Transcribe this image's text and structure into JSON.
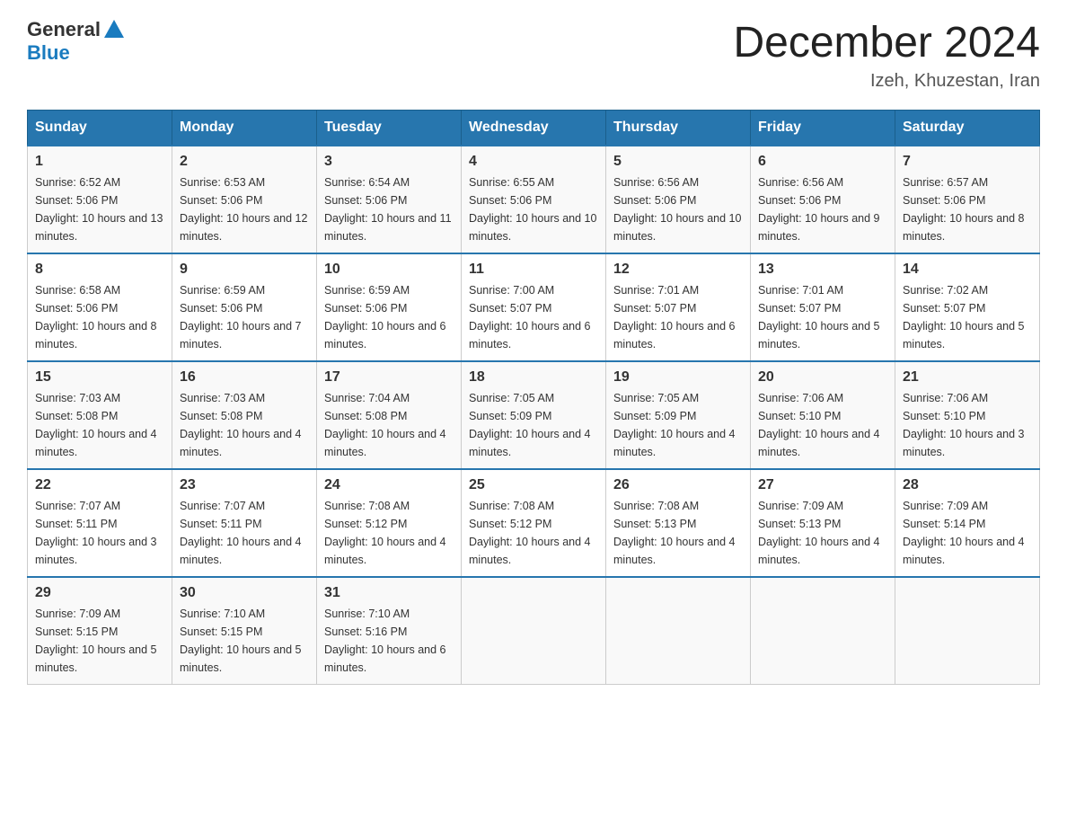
{
  "header": {
    "logo_general": "General",
    "logo_blue": "Blue",
    "month_title": "December 2024",
    "location": "Izeh, Khuzestan, Iran"
  },
  "weekdays": [
    "Sunday",
    "Monday",
    "Tuesday",
    "Wednesday",
    "Thursday",
    "Friday",
    "Saturday"
  ],
  "weeks": [
    [
      {
        "day": "1",
        "sunrise": "6:52 AM",
        "sunset": "5:06 PM",
        "daylight": "10 hours and 13 minutes."
      },
      {
        "day": "2",
        "sunrise": "6:53 AM",
        "sunset": "5:06 PM",
        "daylight": "10 hours and 12 minutes."
      },
      {
        "day": "3",
        "sunrise": "6:54 AM",
        "sunset": "5:06 PM",
        "daylight": "10 hours and 11 minutes."
      },
      {
        "day": "4",
        "sunrise": "6:55 AM",
        "sunset": "5:06 PM",
        "daylight": "10 hours and 10 minutes."
      },
      {
        "day": "5",
        "sunrise": "6:56 AM",
        "sunset": "5:06 PM",
        "daylight": "10 hours and 10 minutes."
      },
      {
        "day": "6",
        "sunrise": "6:56 AM",
        "sunset": "5:06 PM",
        "daylight": "10 hours and 9 minutes."
      },
      {
        "day": "7",
        "sunrise": "6:57 AM",
        "sunset": "5:06 PM",
        "daylight": "10 hours and 8 minutes."
      }
    ],
    [
      {
        "day": "8",
        "sunrise": "6:58 AM",
        "sunset": "5:06 PM",
        "daylight": "10 hours and 8 minutes."
      },
      {
        "day": "9",
        "sunrise": "6:59 AM",
        "sunset": "5:06 PM",
        "daylight": "10 hours and 7 minutes."
      },
      {
        "day": "10",
        "sunrise": "6:59 AM",
        "sunset": "5:06 PM",
        "daylight": "10 hours and 6 minutes."
      },
      {
        "day": "11",
        "sunrise": "7:00 AM",
        "sunset": "5:07 PM",
        "daylight": "10 hours and 6 minutes."
      },
      {
        "day": "12",
        "sunrise": "7:01 AM",
        "sunset": "5:07 PM",
        "daylight": "10 hours and 6 minutes."
      },
      {
        "day": "13",
        "sunrise": "7:01 AM",
        "sunset": "5:07 PM",
        "daylight": "10 hours and 5 minutes."
      },
      {
        "day": "14",
        "sunrise": "7:02 AM",
        "sunset": "5:07 PM",
        "daylight": "10 hours and 5 minutes."
      }
    ],
    [
      {
        "day": "15",
        "sunrise": "7:03 AM",
        "sunset": "5:08 PM",
        "daylight": "10 hours and 4 minutes."
      },
      {
        "day": "16",
        "sunrise": "7:03 AM",
        "sunset": "5:08 PM",
        "daylight": "10 hours and 4 minutes."
      },
      {
        "day": "17",
        "sunrise": "7:04 AM",
        "sunset": "5:08 PM",
        "daylight": "10 hours and 4 minutes."
      },
      {
        "day": "18",
        "sunrise": "7:05 AM",
        "sunset": "5:09 PM",
        "daylight": "10 hours and 4 minutes."
      },
      {
        "day": "19",
        "sunrise": "7:05 AM",
        "sunset": "5:09 PM",
        "daylight": "10 hours and 4 minutes."
      },
      {
        "day": "20",
        "sunrise": "7:06 AM",
        "sunset": "5:10 PM",
        "daylight": "10 hours and 4 minutes."
      },
      {
        "day": "21",
        "sunrise": "7:06 AM",
        "sunset": "5:10 PM",
        "daylight": "10 hours and 3 minutes."
      }
    ],
    [
      {
        "day": "22",
        "sunrise": "7:07 AM",
        "sunset": "5:11 PM",
        "daylight": "10 hours and 3 minutes."
      },
      {
        "day": "23",
        "sunrise": "7:07 AM",
        "sunset": "5:11 PM",
        "daylight": "10 hours and 4 minutes."
      },
      {
        "day": "24",
        "sunrise": "7:08 AM",
        "sunset": "5:12 PM",
        "daylight": "10 hours and 4 minutes."
      },
      {
        "day": "25",
        "sunrise": "7:08 AM",
        "sunset": "5:12 PM",
        "daylight": "10 hours and 4 minutes."
      },
      {
        "day": "26",
        "sunrise": "7:08 AM",
        "sunset": "5:13 PM",
        "daylight": "10 hours and 4 minutes."
      },
      {
        "day": "27",
        "sunrise": "7:09 AM",
        "sunset": "5:13 PM",
        "daylight": "10 hours and 4 minutes."
      },
      {
        "day": "28",
        "sunrise": "7:09 AM",
        "sunset": "5:14 PM",
        "daylight": "10 hours and 4 minutes."
      }
    ],
    [
      {
        "day": "29",
        "sunrise": "7:09 AM",
        "sunset": "5:15 PM",
        "daylight": "10 hours and 5 minutes."
      },
      {
        "day": "30",
        "sunrise": "7:10 AM",
        "sunset": "5:15 PM",
        "daylight": "10 hours and 5 minutes."
      },
      {
        "day": "31",
        "sunrise": "7:10 AM",
        "sunset": "5:16 PM",
        "daylight": "10 hours and 6 minutes."
      },
      null,
      null,
      null,
      null
    ]
  ],
  "labels": {
    "sunrise": "Sunrise:",
    "sunset": "Sunset:",
    "daylight": "Daylight:"
  }
}
